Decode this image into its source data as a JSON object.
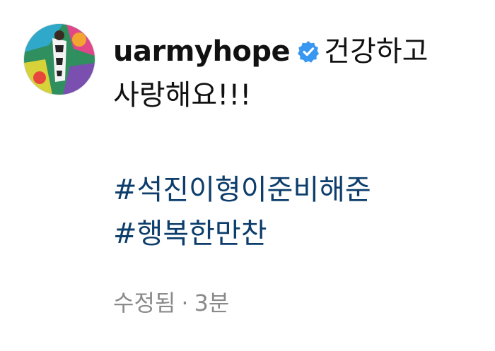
{
  "comment": {
    "username": "uarmyhope",
    "verified_icon": "verified-badge-icon",
    "text_line1": "건강하고",
    "text_line2": "사랑해요!!!",
    "hashtags": [
      "#석진이형이준비해준",
      "#행복한만찬"
    ],
    "edited_label": "수정됨",
    "separator": "·",
    "time_ago": "3분"
  },
  "colors": {
    "text": "#111111",
    "hashtag": "#0c3d6b",
    "meta": "#8a8a8a",
    "verified": "#3897f0"
  }
}
